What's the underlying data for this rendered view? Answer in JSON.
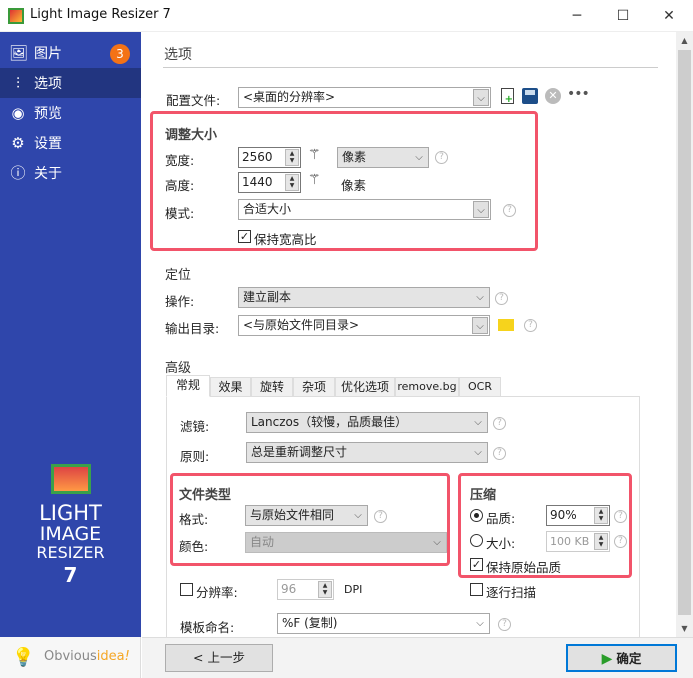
{
  "window": {
    "title": "Light Image Resizer 7",
    "minimize": "─",
    "maximize": "☐",
    "close": "✕"
  },
  "sidebar": {
    "items": [
      {
        "label": "图片",
        "icon": "pictures-icon",
        "badge": "3"
      },
      {
        "label": "选项",
        "icon": "sliders-icon"
      },
      {
        "label": "预览",
        "icon": "eye-icon"
      },
      {
        "label": "设置",
        "icon": "gear-icon"
      },
      {
        "label": "关于",
        "icon": "info-icon"
      }
    ],
    "logo": {
      "line1": "LIGHT",
      "line2": "IMAGE",
      "line3": "RESIZER",
      "line4": "7"
    },
    "brand": {
      "a": "Obvious",
      "b": "idea",
      "c": "!"
    }
  },
  "main": {
    "title": "选项",
    "profile": {
      "label": "配置文件:",
      "value": "<桌面的分辨率>"
    },
    "resize": {
      "title": "调整大小",
      "width_label": "宽度:",
      "width": "2560",
      "unit": "像素",
      "height_label": "高度:",
      "height": "1440",
      "height_unit": "像素",
      "mode_label": "模式:",
      "mode": "合适大小",
      "keep_ratio": "保持宽高比"
    },
    "position": {
      "title": "定位",
      "op_label": "操作:",
      "op": "建立副本",
      "out_label": "输出目录:",
      "out": "<与原始文件同目录>"
    },
    "advanced": {
      "title": "高级",
      "tabs": [
        "常规",
        "效果",
        "旋转",
        "杂项",
        "优化选项",
        "remove.bg",
        "OCR"
      ],
      "filter_label": "滤镜:",
      "filter": "Lanczos（较慢，品质最佳）",
      "rule_label": "原则:",
      "rule": "总是重新调整尺寸",
      "filetype": {
        "title": "文件类型",
        "format_label": "格式:",
        "format": "与原始文件相同",
        "color_label": "颜色:",
        "color": "自动"
      },
      "compress": {
        "title": "压缩",
        "quality_label": "品质:",
        "quality": "90%",
        "size_label": "大小:",
        "size": "100 KB",
        "keep_quality": "保持原始品质"
      },
      "dpi_label": "分辨率:",
      "dpi": "96",
      "dpi_unit": "DPI",
      "progressive": "逐行扫描",
      "template_label": "模板命名:",
      "template": "%F (复制)"
    }
  },
  "footer": {
    "back": "< 上一步",
    "ok": "确定"
  },
  "colors": {
    "sidebar": "#2f46ab",
    "accent_red": "#f2546a",
    "badge": "#f47216"
  }
}
